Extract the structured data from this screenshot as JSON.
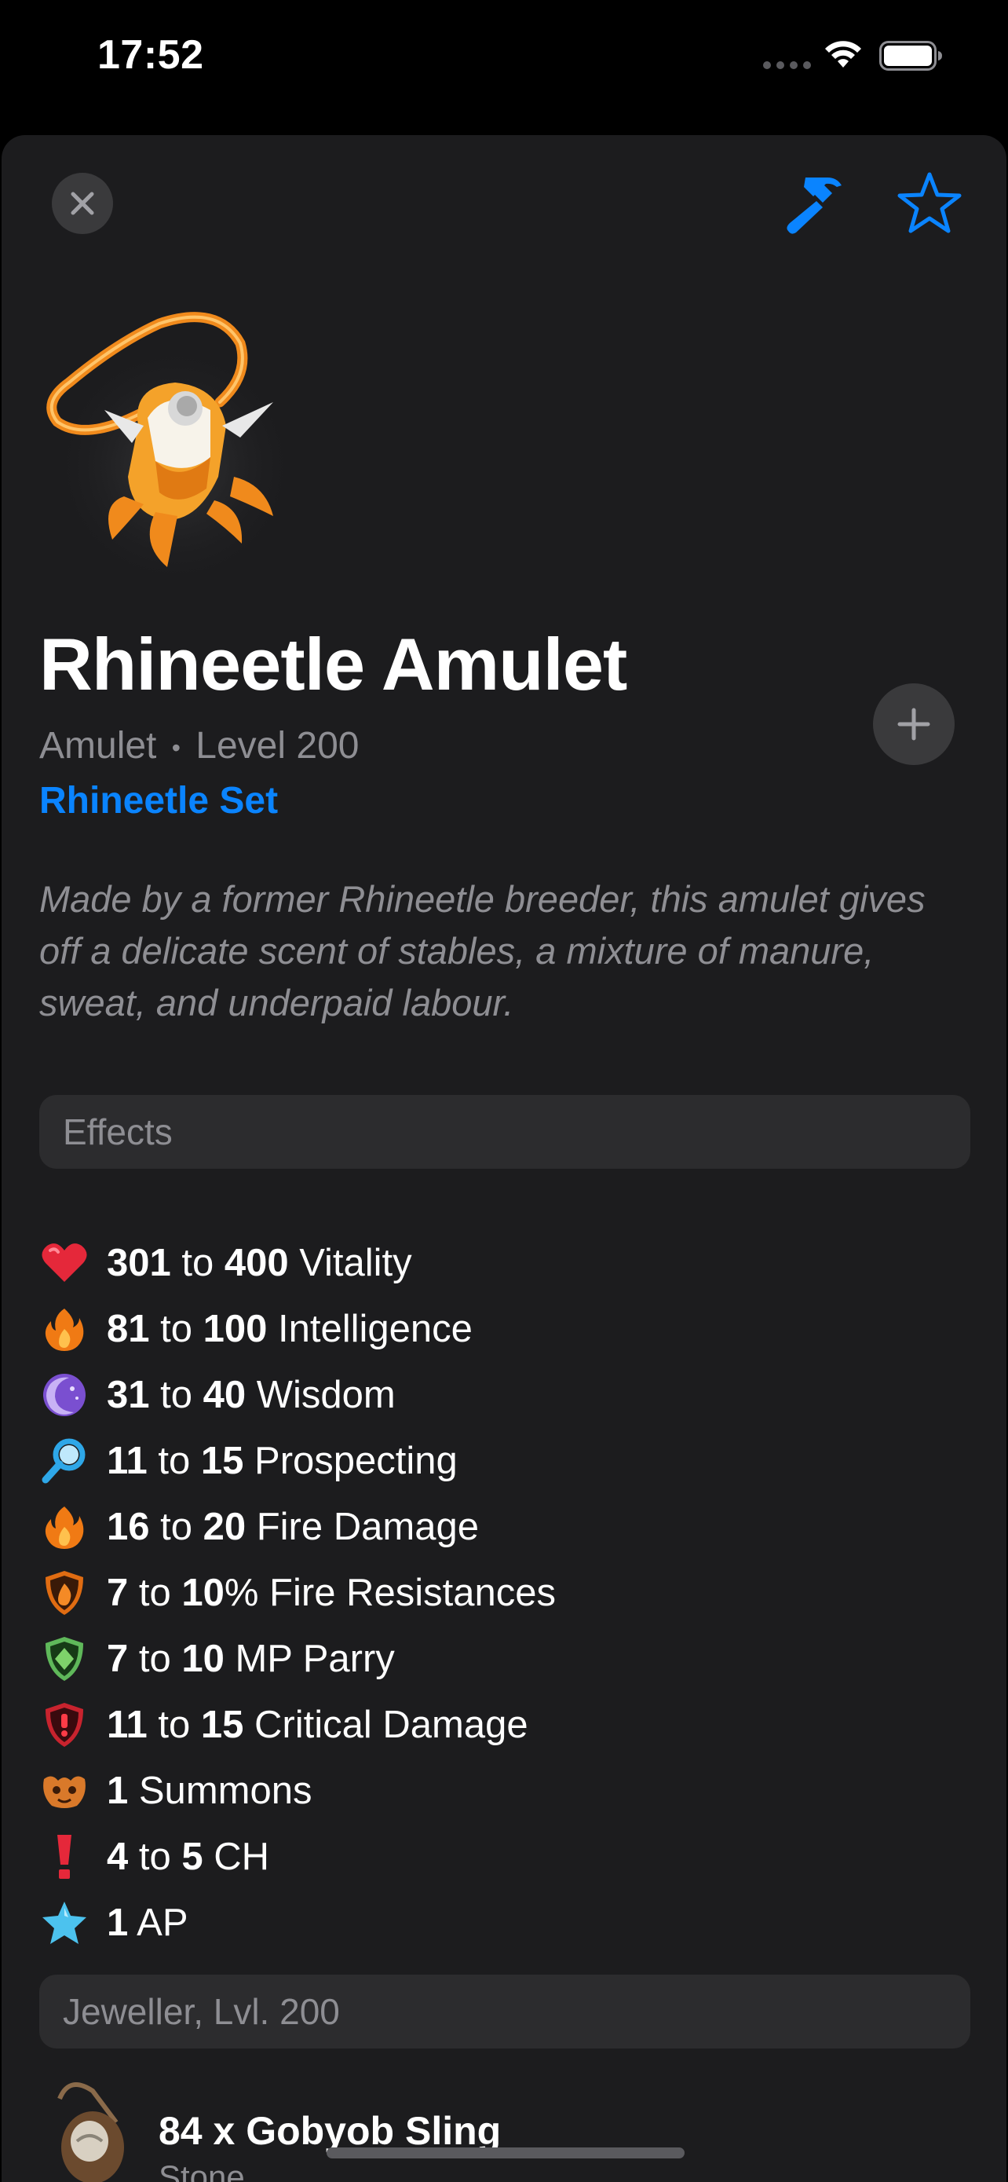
{
  "status_bar": {
    "time": "17:52"
  },
  "header": {
    "close_icon": "close-icon",
    "craft_icon": "hammer-icon",
    "favorite_icon": "star-icon"
  },
  "item": {
    "name": "Rhineetle Amulet",
    "type": "Amulet",
    "separator": "•",
    "level_text": "Level 200",
    "set_name": "Rhineetle Set",
    "description": "Made by a former Rhineetle breeder, this amulet gives off a delicate scent of stables, a mixture of manure, sweat, and underpaid labour."
  },
  "effects_section": {
    "header": "Effects",
    "items": [
      {
        "min": "301",
        "to": " to ",
        "max": "400",
        "label": " Vitality",
        "icon": "heart-icon"
      },
      {
        "min": "81",
        "to": " to ",
        "max": "100",
        "label": " Intelligence",
        "icon": "fire-icon"
      },
      {
        "min": "31",
        "to": " to ",
        "max": "40",
        "label": " Wisdom",
        "icon": "moon-icon"
      },
      {
        "min": "11",
        "to": " to ",
        "max": "15",
        "label": " Prospecting",
        "icon": "magnifier-icon"
      },
      {
        "min": "16",
        "to": " to ",
        "max": "20",
        "label": " Fire Damage",
        "icon": "fire-icon"
      },
      {
        "min": "7",
        "to": " to ",
        "max": "10",
        "label": "% Fire Resistances",
        "icon": "fire-shield-icon"
      },
      {
        "min": "7",
        "to": " to ",
        "max": "10",
        "label": " MP Parry",
        "icon": "mp-shield-icon"
      },
      {
        "min": "11",
        "to": " to ",
        "max": "15",
        "label": " Critical Damage",
        "icon": "crit-shield-icon"
      },
      {
        "min": "1",
        "to": "",
        "max": "",
        "label": " Summons",
        "icon": "summons-icon"
      },
      {
        "min": "4",
        "to": " to ",
        "max": "5",
        "label": " CH",
        "icon": "exclamation-icon"
      },
      {
        "min": "1",
        "to": "",
        "max": "",
        "label": " AP",
        "icon": "star-filled-icon"
      }
    ]
  },
  "recipe_section": {
    "header": "Jeweller, Lvl. 200",
    "items": [
      {
        "name": "84 x Gobyob Sling",
        "sub": "Stone"
      }
    ]
  }
}
